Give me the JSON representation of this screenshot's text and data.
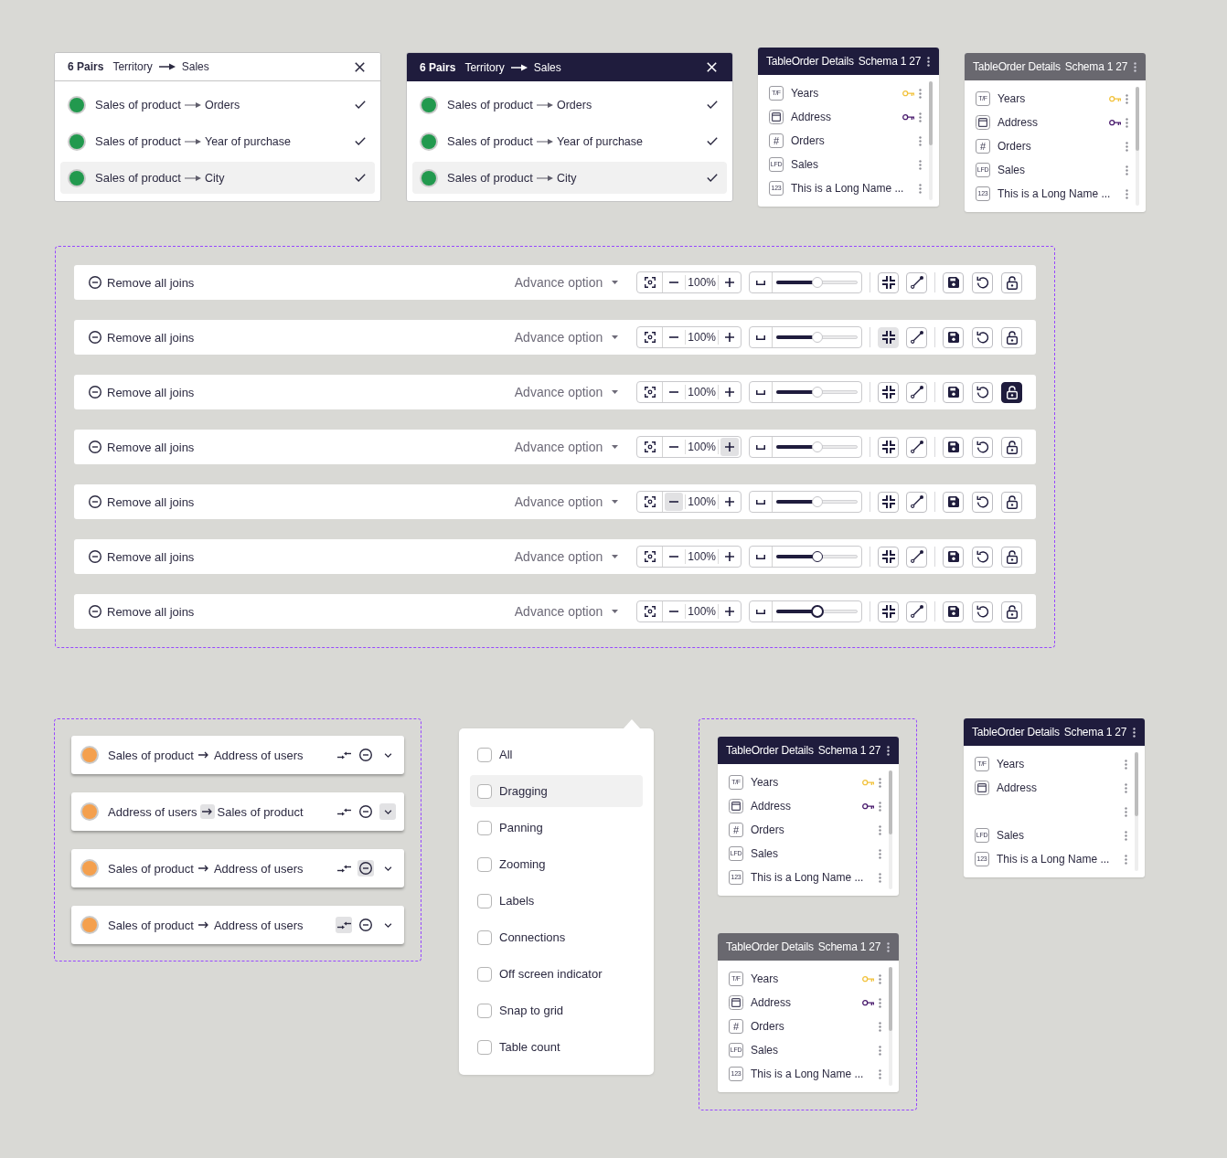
{
  "pair_panels": [
    {
      "kind": "light",
      "count": "6 Pairs",
      "source": "Territory",
      "target": "Sales",
      "rows": [
        {
          "source": "Sales of product",
          "target": "Orders",
          "color": "#22994e",
          "checked": true,
          "selected": false
        },
        {
          "source": "Sales of product",
          "target": "Year of purchase",
          "color": "#22994e",
          "checked": true,
          "selected": false
        },
        {
          "source": "Sales of product",
          "target": "City",
          "color": "#22994e",
          "checked": true,
          "selected": true
        }
      ]
    },
    {
      "kind": "dark",
      "count": "6 Pairs",
      "source": "Territory",
      "target": "Sales",
      "rows": [
        {
          "source": "Sales of product",
          "target": "Orders",
          "color": "#22994e",
          "checked": true,
          "selected": false
        },
        {
          "source": "Sales of product",
          "target": "Year of purchase",
          "color": "#22994e",
          "checked": true,
          "selected": false
        },
        {
          "source": "Sales of product",
          "target": "City",
          "color": "#22994e",
          "checked": true,
          "selected": true
        }
      ]
    }
  ],
  "table_cards": [
    {
      "kind": "dark",
      "title": "TableOrder Details",
      "schema": "Schema 1 27",
      "fields": [
        {
          "kind": "boolean",
          "badge": "T/F",
          "name": "Years",
          "primary_key": true,
          "foreign_key": false
        },
        {
          "kind": "date",
          "name": "Address",
          "primary_key": false,
          "foreign_key": true
        },
        {
          "kind": "number",
          "badge": "#",
          "name": "Orders",
          "primary_key": false,
          "foreign_key": false
        },
        {
          "kind": "text",
          "badge": "LFD",
          "name": "Sales",
          "primary_key": false,
          "foreign_key": false
        },
        {
          "kind": "integer",
          "badge": "123",
          "name": "This is a Long Name ...",
          "primary_key": false,
          "foreign_key": false
        }
      ]
    },
    {
      "kind": "grey",
      "title": "TableOrder Details",
      "schema": "Schema 1 27",
      "fields": [
        {
          "kind": "boolean",
          "badge": "T/F",
          "name": "Years",
          "primary_key": true,
          "foreign_key": false
        },
        {
          "kind": "date",
          "name": "Address",
          "primary_key": false,
          "foreign_key": true
        },
        {
          "kind": "number",
          "badge": "#",
          "name": "Orders",
          "primary_key": false,
          "foreign_key": false
        },
        {
          "kind": "text",
          "badge": "LFD",
          "name": "Sales",
          "primary_key": false,
          "foreign_key": false
        },
        {
          "kind": "integer",
          "badge": "123",
          "name": "This is a Long Name ...",
          "primary_key": false,
          "foreign_key": false
        }
      ]
    }
  ],
  "toolbar_variants": [
    {
      "remove": "Remove all joins",
      "advance": "Advance option",
      "zoom": "100%",
      "minus_hovered": false,
      "plus_hovered": false,
      "level": 0.5,
      "thumb_hovered": false,
      "thumb_pressed": false,
      "fit_hovered": false,
      "lock_active": false
    },
    {
      "remove": "Remove all joins",
      "advance": "Advance option",
      "zoom": "100%",
      "minus_hovered": false,
      "plus_hovered": false,
      "level": 0.5,
      "thumb_hovered": false,
      "thumb_pressed": false,
      "fit_hovered": true,
      "lock_active": false
    },
    {
      "remove": "Remove all joins",
      "advance": "Advance option",
      "zoom": "100%",
      "minus_hovered": false,
      "plus_hovered": false,
      "level": 0.5,
      "thumb_hovered": false,
      "thumb_pressed": false,
      "fit_hovered": false,
      "lock_active": true
    },
    {
      "remove": "Remove all joins",
      "advance": "Advance option",
      "zoom": "100%",
      "minus_hovered": false,
      "plus_hovered": true,
      "level": 0.5,
      "thumb_hovered": false,
      "thumb_pressed": false,
      "fit_hovered": false,
      "lock_active": false
    },
    {
      "remove": "Remove all joins",
      "advance": "Advance option",
      "zoom": "100%",
      "minus_hovered": true,
      "plus_hovered": false,
      "level": 0.5,
      "thumb_hovered": false,
      "thumb_pressed": false,
      "fit_hovered": false,
      "lock_active": false
    },
    {
      "remove": "Remove all joins",
      "advance": "Advance option",
      "zoom": "100%",
      "minus_hovered": false,
      "plus_hovered": false,
      "level": 0.5,
      "thumb_hovered": true,
      "thumb_pressed": false,
      "fit_hovered": false,
      "lock_active": false
    },
    {
      "remove": "Remove all joins",
      "advance": "Advance option",
      "zoom": "100%",
      "minus_hovered": false,
      "plus_hovered": false,
      "level": 0.5,
      "thumb_hovered": false,
      "thumb_pressed": true,
      "fit_hovered": false,
      "lock_active": false
    }
  ],
  "join_rows": [
    {
      "source": "Sales of product",
      "target": "Address of users",
      "color": "#f4a04e",
      "arrow_hovered": false,
      "swap_hovered": false,
      "remove_hovered": false,
      "expand_hovered": false
    },
    {
      "source": "Address of users",
      "target": "Sales of product",
      "color": "#f4a04e",
      "arrow_hovered": true,
      "swap_hovered": false,
      "remove_hovered": false,
      "expand_hovered": true
    },
    {
      "source": "Sales of product",
      "target": "Address of users",
      "color": "#f4a04e",
      "arrow_hovered": false,
      "swap_hovered": false,
      "remove_hovered": true,
      "expand_hovered": false
    },
    {
      "source": "Sales of product",
      "target": "Address of users",
      "color": "#f4a04e",
      "arrow_hovered": false,
      "swap_hovered": true,
      "remove_hovered": false,
      "expand_hovered": false
    }
  ],
  "filter_menu": {
    "options": [
      {
        "label": "All",
        "checked": false,
        "highlighted": false
      },
      {
        "label": "Dragging",
        "checked": false,
        "highlighted": true
      },
      {
        "label": "Panning",
        "checked": false,
        "highlighted": false
      },
      {
        "label": "Zooming",
        "checked": false,
        "highlighted": false
      },
      {
        "label": "Labels",
        "checked": false,
        "highlighted": false
      },
      {
        "label": "Connections",
        "checked": false,
        "highlighted": false
      },
      {
        "label": "Off screen indicator",
        "checked": false,
        "highlighted": false
      },
      {
        "label": "Snap to grid",
        "checked": false,
        "highlighted": false
      },
      {
        "label": "Table count",
        "checked": false,
        "highlighted": false
      }
    ]
  },
  "table_card_variants": [
    {
      "kind": "dark",
      "title": "TableOrder Details",
      "schema": "Schema 1 27",
      "fields": [
        {
          "kind": "boolean",
          "badge": "T/F",
          "name": "Years",
          "primary_key": true,
          "foreign_key": false
        },
        {
          "kind": "date",
          "name": "Address",
          "primary_key": false,
          "foreign_key": true
        },
        {
          "kind": "number",
          "badge": "#",
          "name": "Orders",
          "primary_key": false,
          "foreign_key": false
        },
        {
          "kind": "text",
          "badge": "LFD",
          "name": "Sales",
          "primary_key": false,
          "foreign_key": false
        },
        {
          "kind": "integer",
          "badge": "123",
          "name": "This is a Long Name ...",
          "primary_key": false,
          "foreign_key": false
        }
      ]
    },
    {
      "kind": "grey",
      "title": "TableOrder Details",
      "schema": "Schema 1 27",
      "fields": [
        {
          "kind": "boolean",
          "badge": "T/F",
          "name": "Years",
          "primary_key": true,
          "foreign_key": false
        },
        {
          "kind": "date",
          "name": "Address",
          "primary_key": false,
          "foreign_key": true
        },
        {
          "kind": "number",
          "badge": "#",
          "name": "Orders",
          "primary_key": false,
          "foreign_key": false
        },
        {
          "kind": "text",
          "badge": "LFD",
          "name": "Sales",
          "primary_key": false,
          "foreign_key": false
        },
        {
          "kind": "integer",
          "badge": "123",
          "name": "This is a Long Name ...",
          "primary_key": false,
          "foreign_key": false
        }
      ]
    }
  ],
  "table_card_single": {
    "kind": "dark",
    "title": "TableOrder Details",
    "schema": "Schema 1 27",
    "fields": [
      {
        "kind": "boolean",
        "badge": "T/F",
        "name": "Years",
        "primary_key": false,
        "foreign_key": false
      },
      {
        "kind": "date",
        "name": "Address",
        "primary_key": false,
        "foreign_key": false
      },
      {
        "kind": "placeholder",
        "primary_key": false,
        "foreign_key": false
      },
      {
        "kind": "text",
        "badge": "LFD",
        "name": "Sales",
        "primary_key": false,
        "foreign_key": false
      },
      {
        "kind": "integer",
        "badge": "123",
        "name": "This is a Long Name ...",
        "primary_key": false,
        "foreign_key": false
      }
    ]
  }
}
